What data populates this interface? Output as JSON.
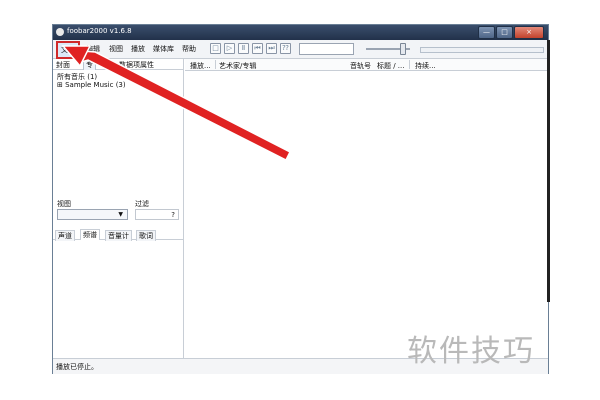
{
  "window": {
    "title": "foobar2000 v1.6.8"
  },
  "menubar": {
    "items": [
      "文件",
      "编辑",
      "视图",
      "播放",
      "媒体库",
      "帮助"
    ]
  },
  "toolbar": {
    "buttons": [
      "stop-icon",
      "play-icon",
      "pause-icon",
      "previous-icon",
      "next-icon",
      "random-icon"
    ],
    "glyphs": [
      "□",
      "▷",
      "Ⅱ",
      "⏮",
      "⏭",
      "⁇"
    ]
  },
  "left_panel": {
    "tabs": [
      "封面",
      "专",
      "数据项属性"
    ],
    "tree": [
      "所有音乐 (1)",
      "⊞ Sample Music (3)"
    ],
    "view_label": "视图",
    "filter_label": "过滤",
    "filter_help": "?",
    "bottom_tabs": [
      "声道",
      "频谱",
      "音量计",
      "歌词"
    ]
  },
  "playlist": {
    "columns": [
      "播放...",
      "艺术家/专辑",
      "音轨号",
      "标题 / ...",
      "持续..."
    ]
  },
  "status": {
    "text": "播放已停止。"
  },
  "watermark": "软件技巧",
  "colors": {
    "highlight": "#d02a2a",
    "arrow": "#e02222"
  }
}
